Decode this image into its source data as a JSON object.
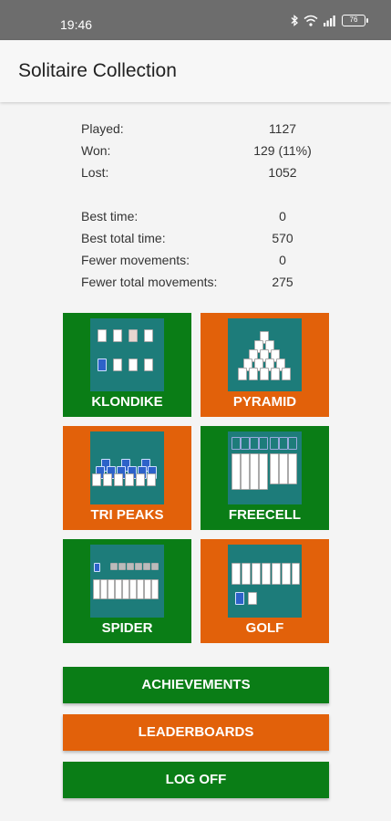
{
  "status": {
    "time": "19:46",
    "battery": "76"
  },
  "app": {
    "title": "Solitaire Collection"
  },
  "stats": {
    "played_label": "Played:",
    "played": "1127",
    "won_label": "Won:",
    "won": "129 (11%)",
    "lost_label": "Lost:",
    "lost": "1052",
    "best_time_label": "Best time:",
    "best_time": "0",
    "best_total_time_label": "Best total time:",
    "best_total_time": "570",
    "fewer_movements_label": "Fewer movements:",
    "fewer_movements": "0",
    "fewer_total_movements_label": "Fewer total movements:",
    "fewer_total_movements": "275"
  },
  "games": {
    "klondike": "KLONDIKE",
    "pyramid": "PYRAMID",
    "tripeaks": "TRI PEAKS",
    "freecell": "FREECELL",
    "spider": "SPIDER",
    "golf": "GOLF"
  },
  "buttons": {
    "achievements": "ACHIEVEMENTS",
    "leaderboards": "LEADERBOARDS",
    "logoff": "LOG OFF"
  },
  "colors": {
    "green": "#0a7d16",
    "orange": "#e2610a",
    "thumb": "#1d7c7a",
    "statusbar": "#6d6d6d"
  },
  "icons": [
    "bluetooth-icon",
    "wifi-icon",
    "sim-signal-icon",
    "battery-icon"
  ]
}
